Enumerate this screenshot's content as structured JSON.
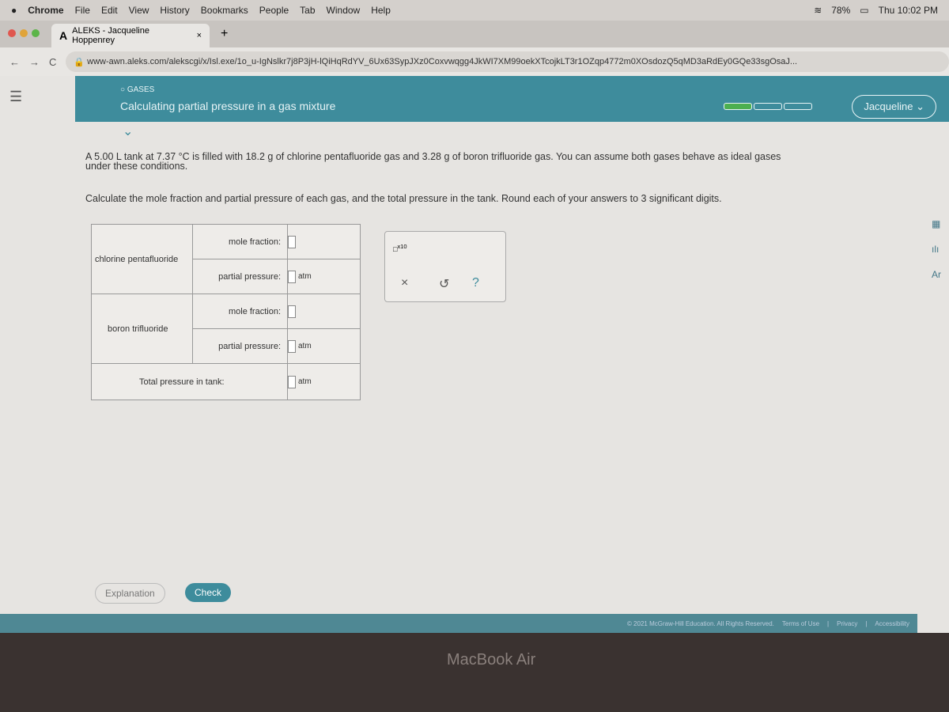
{
  "menubar": {
    "items": [
      "Chrome",
      "File",
      "Edit",
      "View",
      "History",
      "Bookmarks",
      "People",
      "Tab",
      "Window",
      "Help"
    ],
    "battery": "78%",
    "clock": "Thu 10:02 PM"
  },
  "browser": {
    "tab_title": "ALEKS - Jacqueline Hoppenrey",
    "url": "www-awn.aleks.com/alekscgi/x/Isl.exe/1o_u-IgNslkr7j8P3jH-lQiHqRdYV_6Ux63SypJXz0Coxvwqgg4JkWI7XM99oekXTcojkLT3r1OZqp4772m0XOsdozQ5qMD3aRdEy0GQe33sgOsaJ..."
  },
  "header": {
    "topic": "GASES",
    "title": "Calculating partial pressure in a gas mixture",
    "user": "Jacqueline",
    "progress": 0.33,
    "accent": "#3e8c9c"
  },
  "question": {
    "line1": "A 5.00 L tank at 7.37 °C is filled with 18.2 g of chlorine pentafluoride gas and 3.28 g of boron trifluoride gas. You can assume both gases behave as ideal gases",
    "line2": "under these conditions.",
    "line3": "Calculate the mole fraction and partial pressure of each gas, and the total pressure in the tank. Round each of your answers to 3 significant digits."
  },
  "table": {
    "gas1": "chlorine pentafluoride",
    "gas2": "boron trifluoride",
    "mole_fraction": "mole fraction:",
    "partial_pressure": "partial pressure:",
    "total": "Total pressure in tank:",
    "unit": "atm"
  },
  "tools": {
    "sci": "x10",
    "clear": "×",
    "undo": "↺",
    "help": "?"
  },
  "buttons": {
    "explanation": "Explanation",
    "check": "Check"
  },
  "footer": {
    "copyright": "© 2021 McGraw-Hill Education. All Rights Reserved.",
    "terms": "Terms of Use",
    "privacy": "Privacy",
    "accessibility": "Accessibility"
  },
  "bezel": "MacBook Air"
}
